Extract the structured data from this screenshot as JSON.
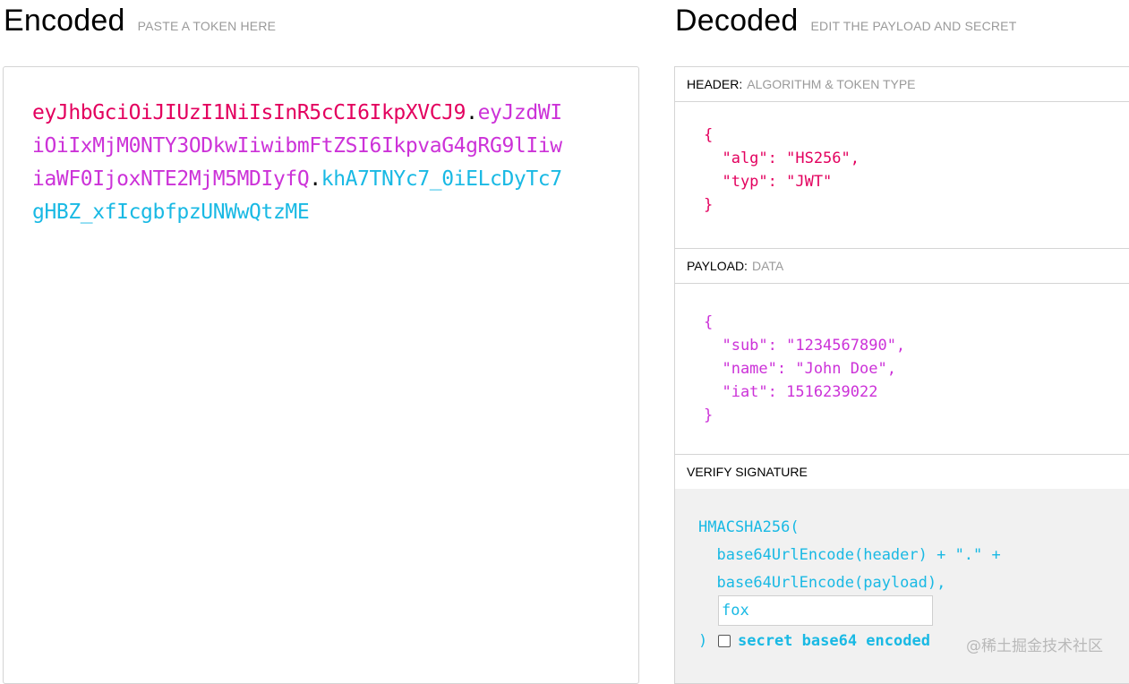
{
  "encoded": {
    "title": "Encoded",
    "subtitle": "PASTE A TOKEN HERE",
    "token_header": "eyJhbGciOiJIUzI1NiIsInR5cCI6IkpXVCJ9",
    "dot1": ".",
    "token_payload": "eyJzdWIiOiIxMjM0NTY3ODkwIiwibmFtZSI6IkpvaG4gRG9lIiwiaWF0IjoxNTE2MjM5MDIyfQ",
    "dot2": ".",
    "token_signature": "khA7TNYc7_0iELcDyTc7gHBZ_xfIcgbfpzUNWwQtzME"
  },
  "decoded": {
    "title": "Decoded",
    "subtitle": "EDIT THE PAYLOAD AND SECRET",
    "header_section": {
      "label": "HEADER:",
      "sublabel": "ALGORITHM & TOKEN TYPE",
      "json_text": "{\n  \"alg\": \"HS256\",\n  \"typ\": \"JWT\"\n}"
    },
    "payload_section": {
      "label": "PAYLOAD:",
      "sublabel": "DATA",
      "json_text": "{\n  \"sub\": \"1234567890\",\n  \"name\": \"John Doe\",\n  \"iat\": 1516239022\n}"
    },
    "verify_section": {
      "label": "VERIFY SIGNATURE",
      "formula": "HMACSHA256(\n  base64UrlEncode(header) + \".\" +\n  base64UrlEncode(payload),",
      "secret_value": "fox",
      "close_paren": ")",
      "checkbox_label": "secret base64 encoded",
      "checkbox_checked": false
    }
  },
  "watermark": "@稀土掘金技术社区",
  "colors": {
    "header": "#e3005e",
    "payload": "#cc32d8",
    "signature": "#19b9e4"
  }
}
